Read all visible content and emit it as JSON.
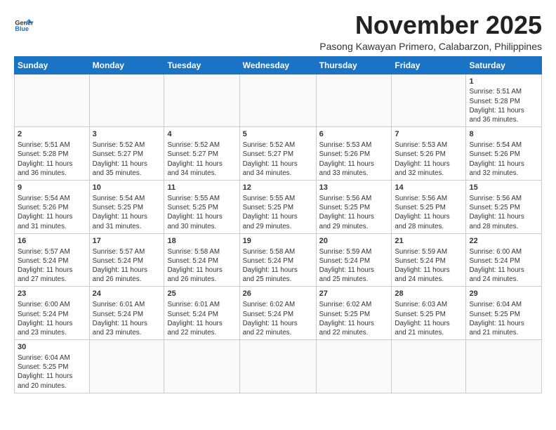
{
  "logo": {
    "text_general": "General",
    "text_blue": "Blue"
  },
  "title": "November 2025",
  "subtitle": "Pasong Kawayan Primero, Calabarzon, Philippines",
  "weekdays": [
    "Sunday",
    "Monday",
    "Tuesday",
    "Wednesday",
    "Thursday",
    "Friday",
    "Saturday"
  ],
  "weeks": [
    [
      {
        "date": "",
        "info": ""
      },
      {
        "date": "",
        "info": ""
      },
      {
        "date": "",
        "info": ""
      },
      {
        "date": "",
        "info": ""
      },
      {
        "date": "",
        "info": ""
      },
      {
        "date": "",
        "info": ""
      },
      {
        "date": "1",
        "info": "Sunrise: 5:51 AM\nSunset: 5:28 PM\nDaylight: 11 hours\nand 36 minutes."
      }
    ],
    [
      {
        "date": "2",
        "info": "Sunrise: 5:51 AM\nSunset: 5:28 PM\nDaylight: 11 hours\nand 36 minutes."
      },
      {
        "date": "3",
        "info": "Sunrise: 5:52 AM\nSunset: 5:27 PM\nDaylight: 11 hours\nand 35 minutes."
      },
      {
        "date": "4",
        "info": "Sunrise: 5:52 AM\nSunset: 5:27 PM\nDaylight: 11 hours\nand 34 minutes."
      },
      {
        "date": "5",
        "info": "Sunrise: 5:52 AM\nSunset: 5:27 PM\nDaylight: 11 hours\nand 34 minutes."
      },
      {
        "date": "6",
        "info": "Sunrise: 5:53 AM\nSunset: 5:26 PM\nDaylight: 11 hours\nand 33 minutes."
      },
      {
        "date": "7",
        "info": "Sunrise: 5:53 AM\nSunset: 5:26 PM\nDaylight: 11 hours\nand 32 minutes."
      },
      {
        "date": "8",
        "info": "Sunrise: 5:54 AM\nSunset: 5:26 PM\nDaylight: 11 hours\nand 32 minutes."
      }
    ],
    [
      {
        "date": "9",
        "info": "Sunrise: 5:54 AM\nSunset: 5:26 PM\nDaylight: 11 hours\nand 31 minutes."
      },
      {
        "date": "10",
        "info": "Sunrise: 5:54 AM\nSunset: 5:25 PM\nDaylight: 11 hours\nand 31 minutes."
      },
      {
        "date": "11",
        "info": "Sunrise: 5:55 AM\nSunset: 5:25 PM\nDaylight: 11 hours\nand 30 minutes."
      },
      {
        "date": "12",
        "info": "Sunrise: 5:55 AM\nSunset: 5:25 PM\nDaylight: 11 hours\nand 29 minutes."
      },
      {
        "date": "13",
        "info": "Sunrise: 5:56 AM\nSunset: 5:25 PM\nDaylight: 11 hours\nand 29 minutes."
      },
      {
        "date": "14",
        "info": "Sunrise: 5:56 AM\nSunset: 5:25 PM\nDaylight: 11 hours\nand 28 minutes."
      },
      {
        "date": "15",
        "info": "Sunrise: 5:56 AM\nSunset: 5:25 PM\nDaylight: 11 hours\nand 28 minutes."
      }
    ],
    [
      {
        "date": "16",
        "info": "Sunrise: 5:57 AM\nSunset: 5:24 PM\nDaylight: 11 hours\nand 27 minutes."
      },
      {
        "date": "17",
        "info": "Sunrise: 5:57 AM\nSunset: 5:24 PM\nDaylight: 11 hours\nand 26 minutes."
      },
      {
        "date": "18",
        "info": "Sunrise: 5:58 AM\nSunset: 5:24 PM\nDaylight: 11 hours\nand 26 minutes."
      },
      {
        "date": "19",
        "info": "Sunrise: 5:58 AM\nSunset: 5:24 PM\nDaylight: 11 hours\nand 25 minutes."
      },
      {
        "date": "20",
        "info": "Sunrise: 5:59 AM\nSunset: 5:24 PM\nDaylight: 11 hours\nand 25 minutes."
      },
      {
        "date": "21",
        "info": "Sunrise: 5:59 AM\nSunset: 5:24 PM\nDaylight: 11 hours\nand 24 minutes."
      },
      {
        "date": "22",
        "info": "Sunrise: 6:00 AM\nSunset: 5:24 PM\nDaylight: 11 hours\nand 24 minutes."
      }
    ],
    [
      {
        "date": "23",
        "info": "Sunrise: 6:00 AM\nSunset: 5:24 PM\nDaylight: 11 hours\nand 23 minutes."
      },
      {
        "date": "24",
        "info": "Sunrise: 6:01 AM\nSunset: 5:24 PM\nDaylight: 11 hours\nand 23 minutes."
      },
      {
        "date": "25",
        "info": "Sunrise: 6:01 AM\nSunset: 5:24 PM\nDaylight: 11 hours\nand 22 minutes."
      },
      {
        "date": "26",
        "info": "Sunrise: 6:02 AM\nSunset: 5:24 PM\nDaylight: 11 hours\nand 22 minutes."
      },
      {
        "date": "27",
        "info": "Sunrise: 6:02 AM\nSunset: 5:25 PM\nDaylight: 11 hours\nand 22 minutes."
      },
      {
        "date": "28",
        "info": "Sunrise: 6:03 AM\nSunset: 5:25 PM\nDaylight: 11 hours\nand 21 minutes."
      },
      {
        "date": "29",
        "info": "Sunrise: 6:04 AM\nSunset: 5:25 PM\nDaylight: 11 hours\nand 21 minutes."
      }
    ],
    [
      {
        "date": "30",
        "info": "Sunrise: 6:04 AM\nSunset: 5:25 PM\nDaylight: 11 hours\nand 20 minutes."
      },
      {
        "date": "",
        "info": ""
      },
      {
        "date": "",
        "info": ""
      },
      {
        "date": "",
        "info": ""
      },
      {
        "date": "",
        "info": ""
      },
      {
        "date": "",
        "info": ""
      },
      {
        "date": "",
        "info": ""
      }
    ]
  ]
}
